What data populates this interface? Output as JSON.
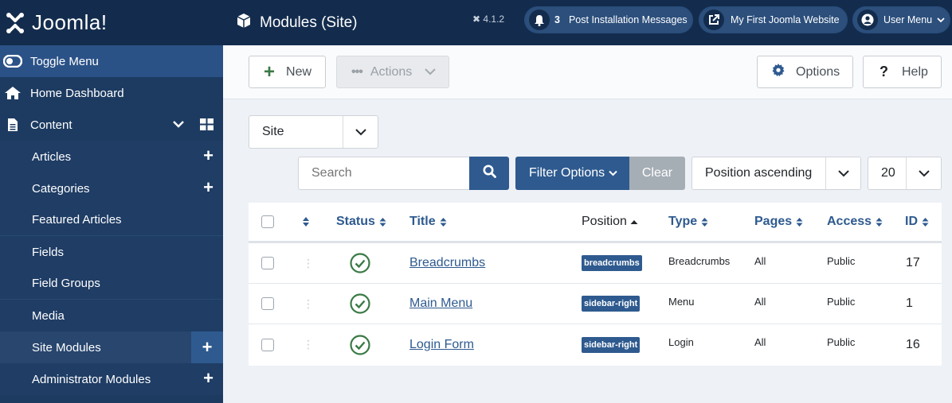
{
  "brand": {
    "logo_text": "Joomla!"
  },
  "sidebar": {
    "toggle": "Toggle Menu",
    "home": "Home Dashboard",
    "content": "Content",
    "items": [
      {
        "label": "Articles"
      },
      {
        "label": "Categories"
      },
      {
        "label": "Featured Articles"
      },
      {
        "label": "Fields"
      },
      {
        "label": "Field Groups"
      },
      {
        "label": "Media"
      },
      {
        "label": "Site Modules"
      },
      {
        "label": "Administrator Modules"
      }
    ]
  },
  "header": {
    "title": "Modules (Site)",
    "version": "4.1.2",
    "notifications_count": "3",
    "post_install": "Post Installation Messages",
    "site_link": "My First Joomla Website",
    "user_menu": "User Menu"
  },
  "toolbar": {
    "new_label": "New",
    "actions_label": "Actions",
    "options_label": "Options",
    "help_label": "Help"
  },
  "filters": {
    "client_select": "Site",
    "search_placeholder": "Search",
    "filter_options": "Filter Options",
    "clear": "Clear",
    "ordering": "Position ascending",
    "limit": "20"
  },
  "table": {
    "headers": {
      "status": "Status",
      "title": "Title",
      "position": "Position",
      "type": "Type",
      "pages": "Pages",
      "access": "Access",
      "id": "ID"
    },
    "rows": [
      {
        "title": "Breadcrumbs",
        "position": "breadcrumbs",
        "type": "Breadcrumbs",
        "pages": "All",
        "access": "Public",
        "id": "17"
      },
      {
        "title": "Main Menu",
        "position": "sidebar-right",
        "type": "Menu",
        "pages": "All",
        "access": "Public",
        "id": "1"
      },
      {
        "title": "Login Form",
        "position": "sidebar-right",
        "type": "Login",
        "pages": "All",
        "access": "Public",
        "id": "16"
      }
    ]
  },
  "colors": {
    "sidebar": "#1d3b61",
    "header": "#132c4d",
    "accent": "#2e5a8f",
    "success": "#3b7a46"
  }
}
